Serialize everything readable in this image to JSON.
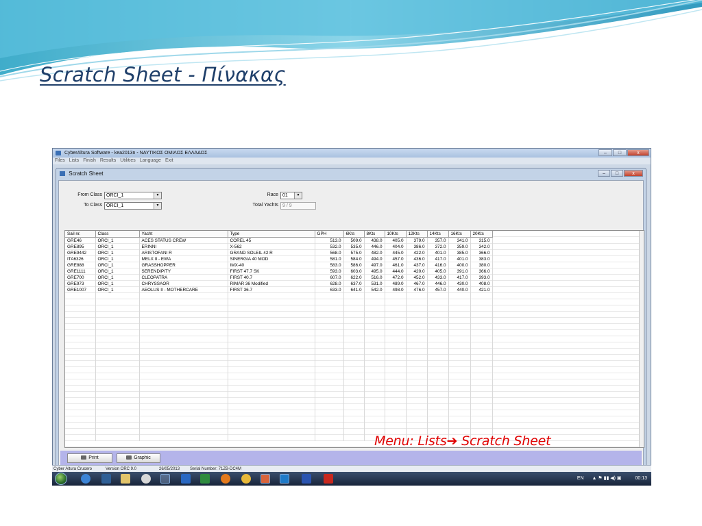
{
  "slide": {
    "title": "Scratch Sheet - Πίνακας",
    "annotation": "Menu: Lists➔ Scratch Sheet"
  },
  "app": {
    "title": "CyberAltura Software  - kea2013n - ΝΑΥΤΙΚΟΣ ΟΜΙΛΟΣ ΕΛΛΑΔΟΣ",
    "window_buttons": {
      "minimize": "–",
      "maximize": "□",
      "close": "x"
    },
    "menu": [
      "Files",
      "Lists",
      "Finish",
      "Results",
      "Utilities",
      "Language",
      "Exit"
    ]
  },
  "scratch_sheet": {
    "title": "Scratch Sheet",
    "from_class_label": "From Class",
    "from_class_value": "ORCI_1",
    "to_class_label": "To Class",
    "to_class_value": "ORCI_1",
    "race_label": "Race",
    "race_value": "01",
    "total_yachts_label": "Total Yachts",
    "total_yachts_value": "9 / 9",
    "columns": [
      "Sail nr.",
      "Class",
      "Yacht",
      "Type",
      "GPH",
      "6Kts",
      "8Kts",
      "10Kts",
      "12Kts",
      "14Kts",
      "16Kts",
      "20Kts"
    ],
    "rows": [
      [
        "GRE46",
        "ORCI_1",
        "ACES STATUS CREW",
        "COREL 45",
        "513.0",
        "509.0",
        "438.0",
        "405.0",
        "379.0",
        "357.0",
        "341.0",
        "315.0"
      ],
      [
        "GRE895",
        "ORCI_1",
        "ERINNI",
        "X-562",
        "532.0",
        "535.0",
        "446.0",
        "404.0",
        "386.0",
        "372.0",
        "359.0",
        "342.0"
      ],
      [
        "GRE9442",
        "ORCI_1",
        "ARISTOFANI R",
        "GRAND SOLEIL 42 R",
        "568.0",
        "575.0",
        "482.0",
        "445.0",
        "422.0",
        "401.0",
        "385.0",
        "366.0"
      ],
      [
        "ITA6326",
        "ORCI_1",
        "MELX II - EWA",
        "SINERGIA 40 MOD",
        "581.0",
        "584.0",
        "494.0",
        "457.0",
        "436.0",
        "417.0",
        "401.0",
        "383.0"
      ],
      [
        "GRE888",
        "ORCI_1",
        "GRASSHOPPER",
        "IMX-40",
        "583.0",
        "586.0",
        "497.0",
        "461.0",
        "437.0",
        "416.0",
        "400.0",
        "380.0"
      ],
      [
        "GRE1111",
        "ORCI_1",
        "SERENDIPITY",
        "FIRST 47.7 SK",
        "593.0",
        "603.0",
        "495.0",
        "444.0",
        "420.0",
        "405.0",
        "391.0",
        "366.0"
      ],
      [
        "GRE700",
        "ORCI_1",
        "CLEOPATRA",
        "FIRST 40.7",
        "607.0",
        "622.0",
        "516.0",
        "472.0",
        "452.0",
        "433.0",
        "417.0",
        "393.0"
      ],
      [
        "GRE973",
        "ORCI_1",
        "CHRYSSAOR",
        "RIMAR 36 Modified",
        "628.0",
        "637.0",
        "531.0",
        "489.0",
        "467.0",
        "446.0",
        "430.0",
        "408.0"
      ],
      [
        "GRE1007",
        "ORCI_1",
        "AEOLUS II - MOTHERCARE",
        "FIRST 36.7",
        "633.0",
        "641.0",
        "542.0",
        "498.0",
        "476.0",
        "457.0",
        "440.0",
        "421.0"
      ]
    ],
    "print_button": "Print",
    "graphic_button": "Graphic"
  },
  "status_bar": {
    "app_name": "Cyber Altura Crucero",
    "version": "Version ORC 9.0",
    "date": "26/05/2013",
    "serial": "Serial Number: 71ZB-DC4M"
  },
  "taskbar": {
    "language": "EN",
    "time": "00:13"
  }
}
